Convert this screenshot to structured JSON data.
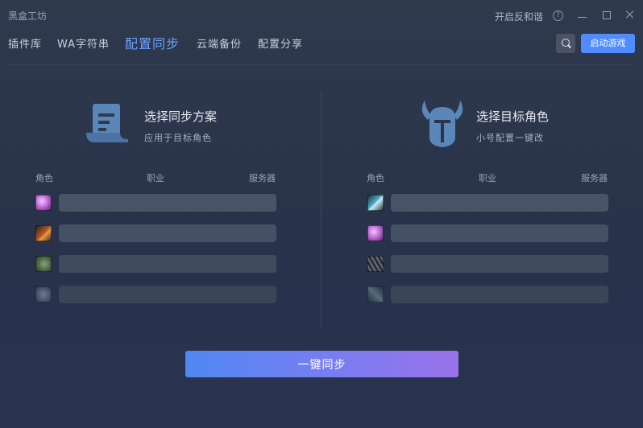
{
  "app": {
    "title": "黑盒工坊"
  },
  "window": {
    "harmony_label": "开启反和谐",
    "help_symbol": "?"
  },
  "nav": {
    "tabs": [
      {
        "label": "插件库",
        "active": false
      },
      {
        "label": "WA字符串",
        "active": false
      },
      {
        "label": "配置同步",
        "active": true
      },
      {
        "label": "云端备份",
        "active": false
      },
      {
        "label": "配置分享",
        "active": false
      }
    ],
    "start_label": "启动游戏"
  },
  "left_panel": {
    "title": "选择同步方案",
    "subtitle": "应用于目标角色",
    "icon": "scroll-document-icon",
    "columns": [
      "角色",
      "职业",
      "服务器"
    ],
    "rows": [
      {
        "icon": "class-icon-arcane",
        "color": "#c06ad8"
      },
      {
        "icon": "class-icon-fire-staff",
        "color": "#b55a22"
      },
      {
        "icon": "class-icon-nature",
        "color": "#5c7a4a"
      },
      {
        "icon": "class-icon-frost",
        "color": "#6a7a96"
      }
    ]
  },
  "right_panel": {
    "title": "选择目标角色",
    "subtitle": "小号配置一键改",
    "icon": "horned-helmet-icon",
    "columns": [
      "角色",
      "职业",
      "服务器"
    ],
    "rows": [
      {
        "icon": "class-icon-frost-axe",
        "color": "#4ea6c0"
      },
      {
        "icon": "class-icon-arcane",
        "color": "#c06ad8"
      },
      {
        "icon": "class-icon-claw",
        "color": "#7b7f88"
      },
      {
        "icon": "class-icon-blade",
        "color": "#7a9aa2"
      }
    ]
  },
  "action": {
    "sync_label": "一键同步"
  },
  "colors": {
    "accent": "#4e8cff",
    "active_tab": "#6fa1ff",
    "panel_icon": "#5b86b8"
  }
}
